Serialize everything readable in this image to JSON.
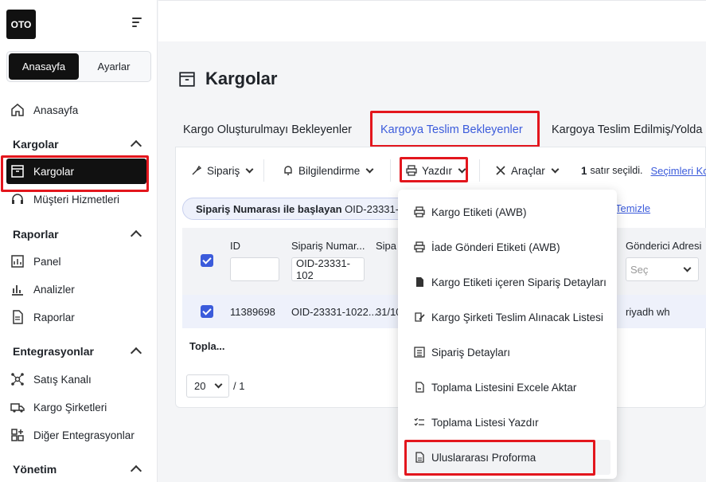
{
  "sidebar": {
    "logo": "OTO",
    "segment": {
      "home": "Anasayfa",
      "settings": "Ayarlar"
    },
    "home_item": "Anasayfa",
    "groups": {
      "kargolar": "Kargolar",
      "raporlar": "Raporlar",
      "entegrasyonlar": "Entegrasyonlar",
      "yonetim": "Yönetim"
    },
    "items": {
      "kargolar": "Kargolar",
      "musteri": "Müşteri Hizmetleri",
      "panel": "Panel",
      "analizler": "Analizler",
      "raporlar": "Raporlar",
      "satis": "Satış Kanalı",
      "kargo_sirketleri": "Kargo Şirketleri",
      "diger": "Diğer Entegrasyonlar"
    }
  },
  "page": {
    "title": "Kargolar"
  },
  "tabs": {
    "t1": "Kargo Oluşturulmayı Bekleyenler",
    "t2": "Kargoya Teslim Bekleyenler",
    "t3": "Kargoya Teslim Edilmiş/Yolda"
  },
  "toolbar": {
    "siparis": "Sipariş",
    "bilgilendirme": "Bilgilendirme",
    "yazdir": "Yazdır",
    "araclar": "Araçlar",
    "selected_count": "1",
    "selected_text": "satır seçildi.",
    "clear_link": "Seçimleri Ko"
  },
  "filter": {
    "label": "Sipariş Numarası ile başlayan",
    "value": "OID-23331-",
    "clear": "Temizle"
  },
  "table": {
    "headers": {
      "id": "ID",
      "siparis": "Sipariş Numar...",
      "sipa": "Sipa",
      "gonderici": "Gönderici Adresi"
    },
    "filters": {
      "siparis": "OID-23331-102",
      "gonderici_placeholder": "Seç"
    },
    "row": {
      "id": "11389698",
      "siparis": "OID-23331-1022...",
      "date": "31/10",
      "gonderici": "riyadh wh"
    },
    "footer": "Topla..."
  },
  "pager": {
    "size": "20",
    "pages": "/ 1"
  },
  "print_menu": {
    "items": [
      "Kargo Etiketi (AWB)",
      "İade Gönderi Etiketi (AWB)",
      "Kargo Etiketi içeren Sipariş Detayları",
      "Kargo Şirketi Teslim Alınacak Listesi",
      "Sipariş Detayları",
      "Toplama Listesini Excele Aktar",
      "Toplama Listesi Yazdır",
      "Uluslararası Proforma"
    ]
  },
  "colors": {
    "accent": "#3b5bdb",
    "highlight": "#e3161d",
    "active_nav": "#111111"
  }
}
